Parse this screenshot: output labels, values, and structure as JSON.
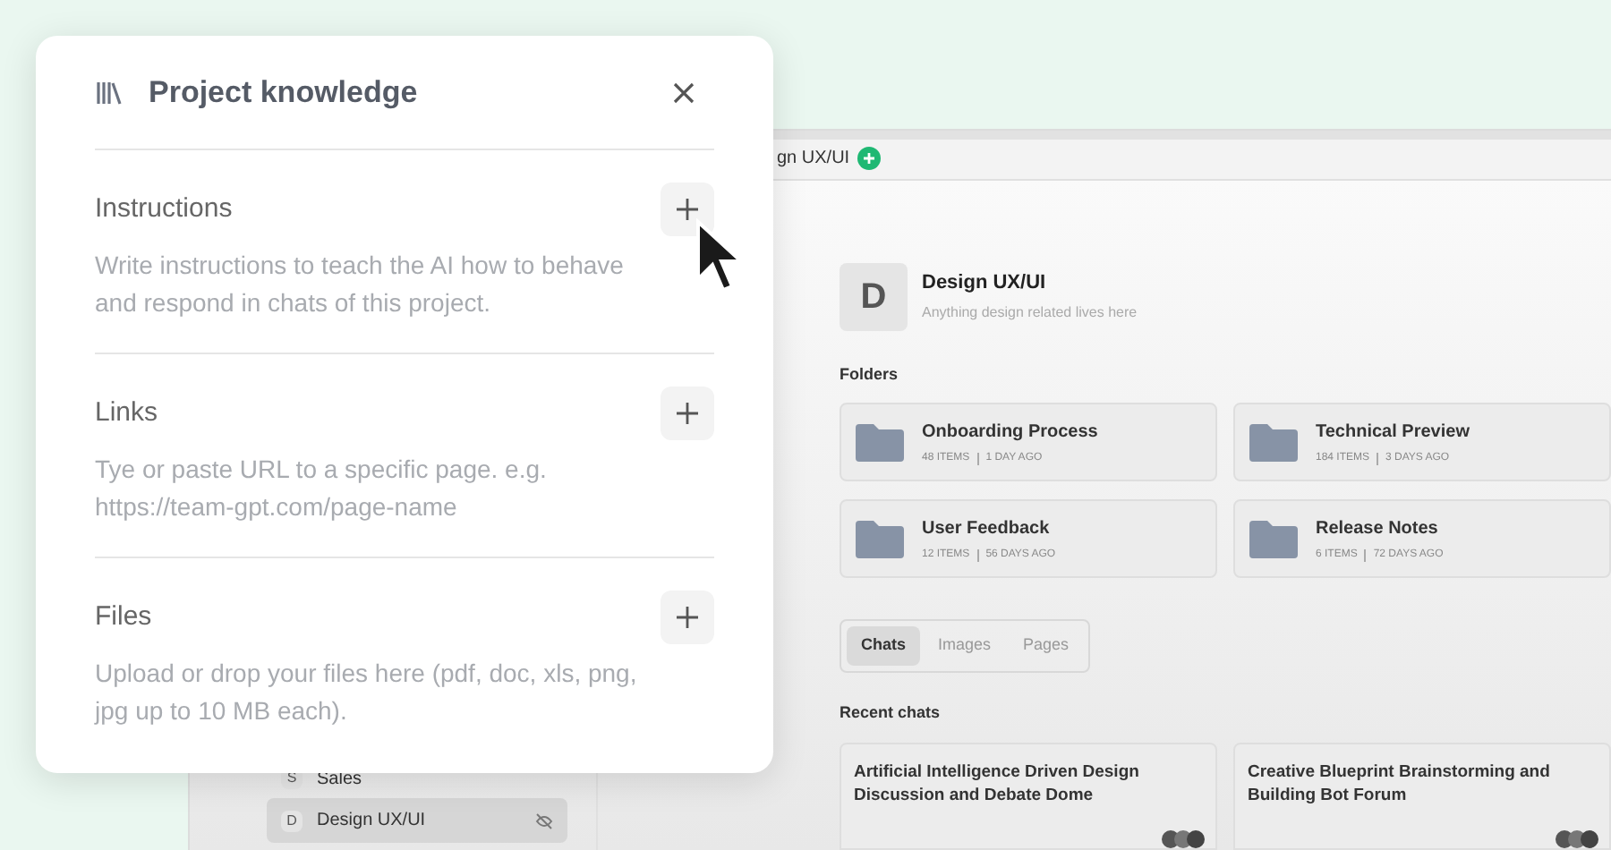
{
  "app": {
    "tab_title": "gn UX/UI",
    "sidebar": {
      "items": [
        {
          "initial": "S",
          "label": "Sales",
          "selected": false
        },
        {
          "initial": "D",
          "label": "Design UX/UI",
          "selected": true
        }
      ]
    },
    "project": {
      "initial": "D",
      "name": "Design UX/UI",
      "description": "Anything design related lives here"
    },
    "folders_heading": "Folders",
    "folders": [
      {
        "name": "Onboarding Process",
        "items": "48 ITEMS",
        "age": "1 DAY AGO"
      },
      {
        "name": "Technical Preview",
        "items": "184 ITEMS",
        "age": "3 DAYS AGO"
      },
      {
        "name": "User Feedback",
        "items": "12 ITEMS",
        "age": "56 DAYS AGO"
      },
      {
        "name": "Release Notes",
        "items": "6 ITEMS",
        "age": "72 DAYS AGO"
      }
    ],
    "tabs": [
      {
        "label": "Chats",
        "selected": true
      },
      {
        "label": "Images",
        "selected": false
      },
      {
        "label": "Pages",
        "selected": false
      }
    ],
    "recent_heading": "Recent chats",
    "chats": [
      {
        "title": "Artificial Intelligence Driven Design Discussion and Debate Dome"
      },
      {
        "title": "Creative Blueprint Brainstorming and Building Bot Forum"
      }
    ]
  },
  "dialog": {
    "title": "Project knowledge",
    "sections": [
      {
        "title": "Instructions",
        "description": "Write instructions to teach the AI how to behave and respond in chats of this project."
      },
      {
        "title": "Links",
        "description": "Tye or paste URL to a specific page. e.g. https://team-gpt.com/page-name"
      },
      {
        "title": "Files",
        "description": "Upload or drop your files here (pdf, doc, xls, png, jpg up to 10 MB each)."
      }
    ]
  }
}
